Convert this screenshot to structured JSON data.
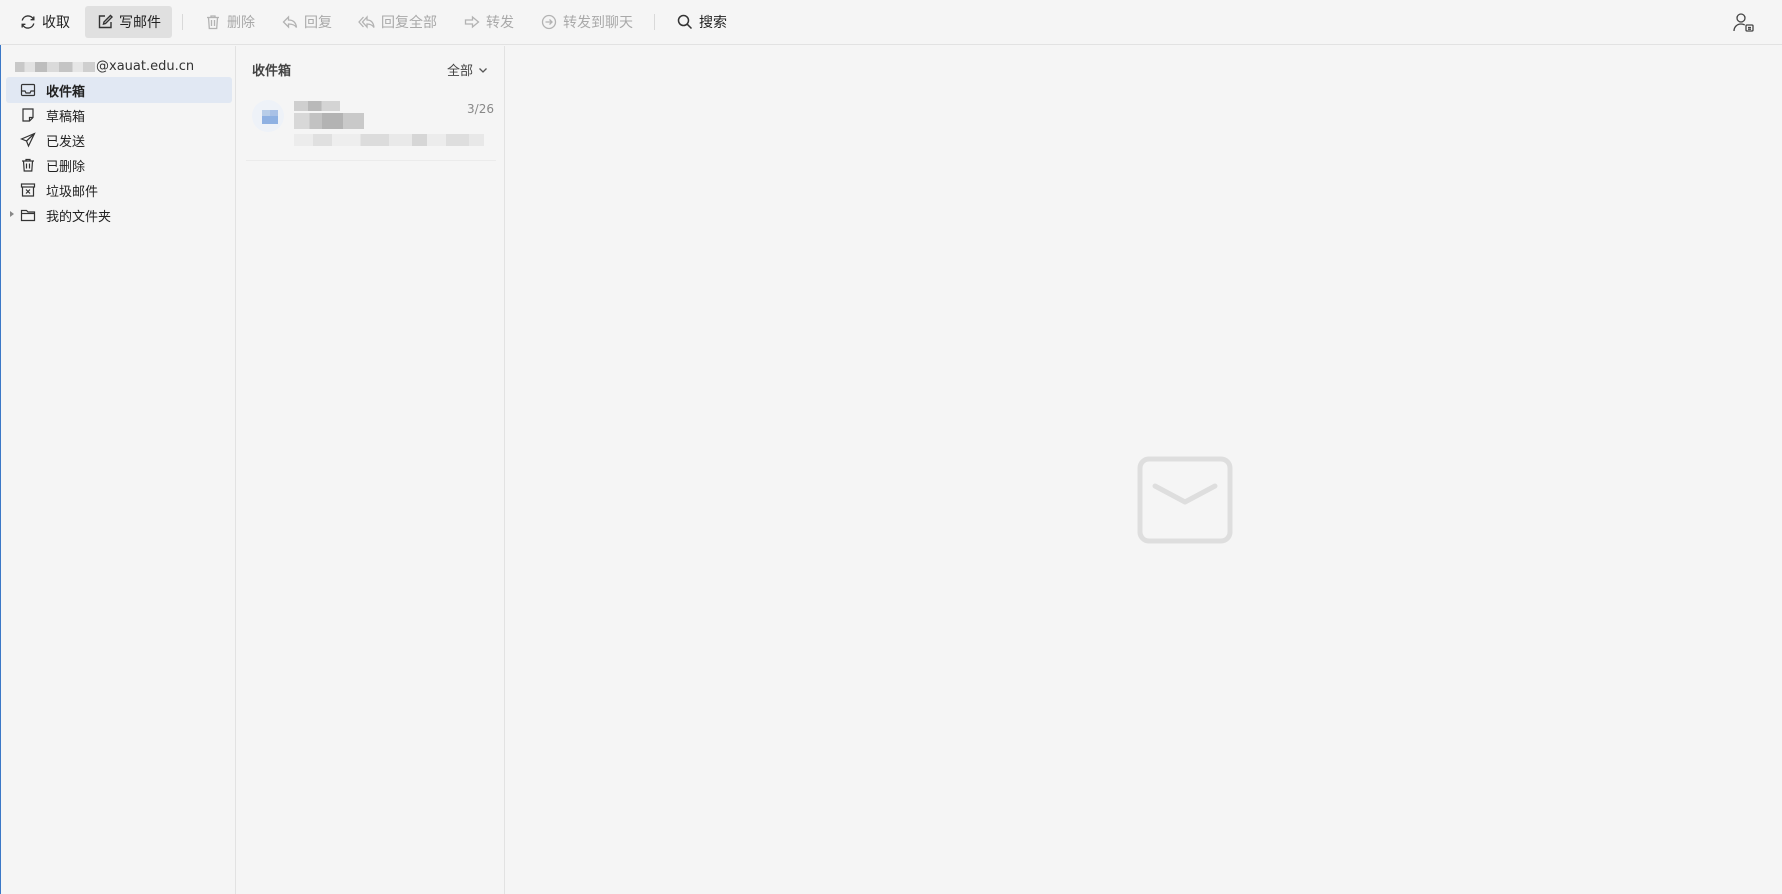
{
  "toolbar": {
    "receive_label": "收取",
    "compose_label": "写邮件",
    "delete_label": "删除",
    "reply_label": "回复",
    "reply_all_label": "回复全部",
    "forward_label": "转发",
    "forward_chat_label": "转发到聊天",
    "search_label": "搜索"
  },
  "sidebar": {
    "account_suffix": "@xauat.edu.cn",
    "folders": [
      {
        "label": "收件箱",
        "icon": "inbox-icon",
        "selected": true
      },
      {
        "label": "草稿箱",
        "icon": "drafts-icon"
      },
      {
        "label": "已发送",
        "icon": "send-icon"
      },
      {
        "label": "已删除",
        "icon": "trash-icon"
      },
      {
        "label": "垃圾邮件",
        "icon": "spam-icon"
      },
      {
        "label": "我的文件夹",
        "icon": "folder-icon"
      }
    ]
  },
  "message_list": {
    "title": "收件箱",
    "filter_label": "全部",
    "items": [
      {
        "date": "3/26"
      }
    ]
  },
  "colors": {
    "background": "#f5f5f5",
    "selected_folder": "#e1e8f3",
    "disabled_text": "#a9a9a9"
  }
}
